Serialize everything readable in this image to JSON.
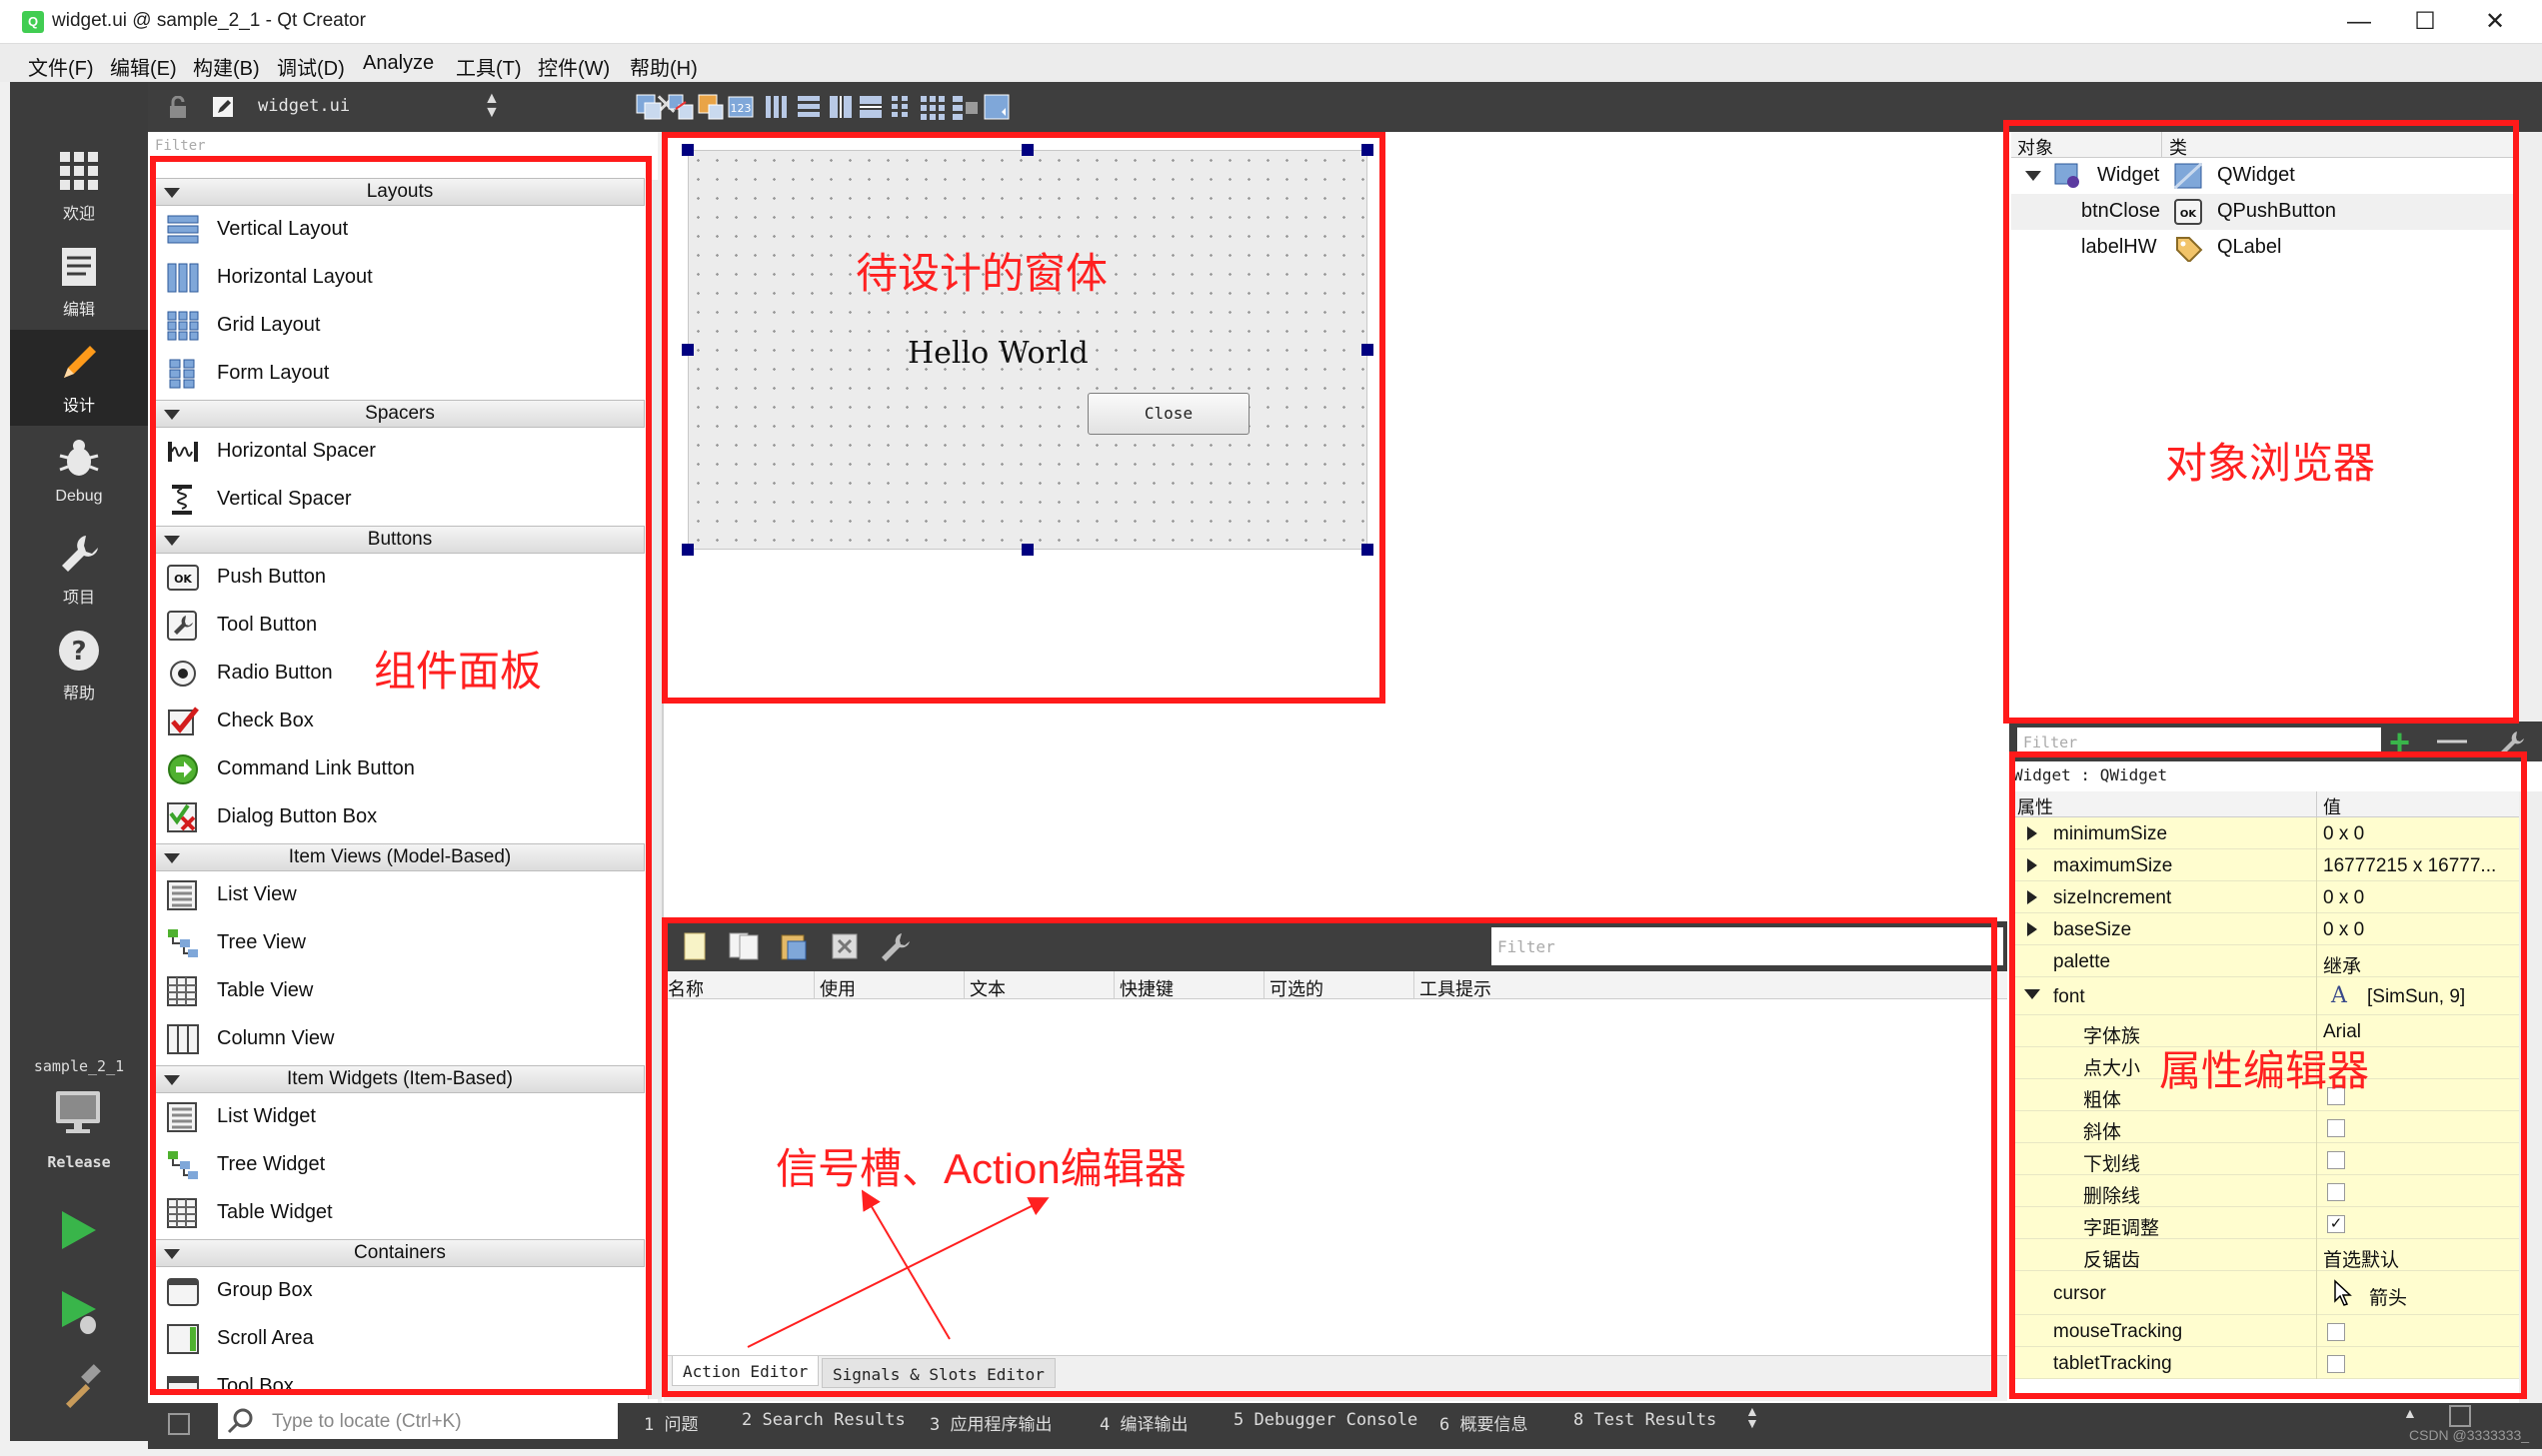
{
  "window": {
    "title": "widget.ui @ sample_2_1 - Qt Creator",
    "logo_text": "Q",
    "minimize_glyph": "—",
    "maximize_glyph": "☐",
    "close_glyph": "✕"
  },
  "menubar": [
    "文件(F)",
    "编辑(E)",
    "构建(B)",
    "调试(D)",
    "Analyze",
    "工具(T)",
    "控件(W)",
    "帮助(H)"
  ],
  "modebar": {
    "modes": [
      {
        "label": "欢迎",
        "icon": "grid-icon",
        "active": false
      },
      {
        "label": "编辑",
        "icon": "document-icon",
        "active": false
      },
      {
        "label": "设计",
        "icon": "pencil-icon",
        "active": true
      },
      {
        "label": "Debug",
        "icon": "bug-icon",
        "active": false
      },
      {
        "label": "项目",
        "icon": "wrench-icon",
        "active": false
      },
      {
        "label": "帮助",
        "icon": "help-icon",
        "active": false
      }
    ],
    "kit_name": "sample_2_1",
    "kit_mode": "Release",
    "run_icon": "run-icon",
    "debug_run_icon": "debug-run-icon",
    "build_icon": "hammer-icon"
  },
  "form_toolbar": {
    "file_name": "widget.ui",
    "close_glyph": "✕"
  },
  "widget_box": {
    "filter_placeholder": "Filter",
    "categories": [
      {
        "name": "Layouts",
        "items": [
          "Vertical Layout",
          "Horizontal Layout",
          "Grid Layout",
          "Form Layout"
        ]
      },
      {
        "name": "Spacers",
        "items": [
          "Horizontal Spacer",
          "Vertical Spacer"
        ]
      },
      {
        "name": "Buttons",
        "items": [
          "Push Button",
          "Tool Button",
          "Radio Button",
          "Check Box",
          "Command Link Button",
          "Dialog Button Box"
        ]
      },
      {
        "name": "Item Views (Model-Based)",
        "items": [
          "List View",
          "Tree View",
          "Table View",
          "Column View"
        ]
      },
      {
        "name": "Item Widgets (Item-Based)",
        "items": [
          "List Widget",
          "Tree Widget",
          "Table Widget"
        ]
      },
      {
        "name": "Containers",
        "items": [
          "Group Box",
          "Scroll Area",
          "Tool Box"
        ]
      }
    ]
  },
  "form": {
    "label_text": "Hello World",
    "button_text": "Close"
  },
  "action_editor": {
    "filter_placeholder": "Filter",
    "columns": [
      "名称",
      "使用",
      "文本",
      "快捷键",
      "可选的",
      "工具提示"
    ],
    "tabs": [
      "Action Editor",
      "Signals & Slots Editor"
    ],
    "active_tab": 0
  },
  "object_inspector": {
    "columns": [
      "对象",
      "类"
    ],
    "rows": [
      {
        "object": "Widget",
        "class": "QWidget",
        "expanded": true,
        "selected": false
      },
      {
        "object": "btnClose",
        "class": "QPushButton",
        "selected": true
      },
      {
        "object": "labelHW",
        "class": "QLabel",
        "selected": false
      }
    ],
    "filter_placeholder": "Filter",
    "add_glyph": "+",
    "remove_glyph": "—"
  },
  "property_editor": {
    "class_line": "Widget : QWidget",
    "columns": [
      "属性",
      "值"
    ],
    "rows": [
      {
        "name": "minimumSize",
        "value": "0 x 0",
        "expand": "collapsed",
        "level": 0
      },
      {
        "name": "maximumSize",
        "value": "16777215 x 16777...",
        "expand": "collapsed",
        "level": 0
      },
      {
        "name": "sizeIncrement",
        "value": "0 x 0",
        "expand": "collapsed",
        "level": 0
      },
      {
        "name": "baseSize",
        "value": "0 x 0",
        "expand": "collapsed",
        "level": 0
      },
      {
        "name": "palette",
        "value": "继承",
        "expand": "none",
        "level": 0
      },
      {
        "name": "font",
        "value": "[SimSun, 9]",
        "value_icon": "A",
        "expand": "expanded",
        "level": 0
      },
      {
        "name": "字体族",
        "value": "Arial",
        "expand": "none",
        "level": 1
      },
      {
        "name": "点大小",
        "value": "",
        "expand": "none",
        "level": 1
      },
      {
        "name": "粗体",
        "value": "",
        "checkbox": false,
        "expand": "none",
        "level": 1
      },
      {
        "name": "斜体",
        "value": "",
        "checkbox": false,
        "expand": "none",
        "level": 1
      },
      {
        "name": "下划线",
        "value": "",
        "checkbox": false,
        "expand": "none",
        "level": 1
      },
      {
        "name": "删除线",
        "value": "",
        "checkbox": false,
        "expand": "none",
        "level": 1
      },
      {
        "name": "字距调整",
        "value": "",
        "checkbox": true,
        "expand": "none",
        "level": 1
      },
      {
        "name": "反锯齿",
        "value": "首选默认",
        "expand": "none",
        "level": 1
      },
      {
        "name": "cursor",
        "value": "箭头",
        "value_icon": "cursor-arrow-icon",
        "expand": "none",
        "level": 0
      },
      {
        "name": "mouseTracking",
        "value": "",
        "checkbox": false,
        "expand": "none",
        "level": 0
      },
      {
        "name": "tabletTracking",
        "value": "",
        "checkbox": false,
        "expand": "none",
        "level": 0
      }
    ]
  },
  "statusbar": {
    "locate_placeholder": "Type to locate (Ctrl+K)",
    "tabs": [
      "1 问题",
      "2 Search Results",
      "3 应用程序输出",
      "4 编译输出",
      "5 Debugger Console",
      "6 概要信息",
      "8 Test Results"
    ],
    "watermark": "CSDN @3333333_"
  },
  "annotations": {
    "form_label": "待设计的窗体",
    "widget_box_label": "组件面板",
    "object_inspector_label": "对象浏览器",
    "property_editor_label": "属性编辑器",
    "action_editor_label": "信号槽、Action编辑器",
    "color": "#ff1a1a"
  }
}
